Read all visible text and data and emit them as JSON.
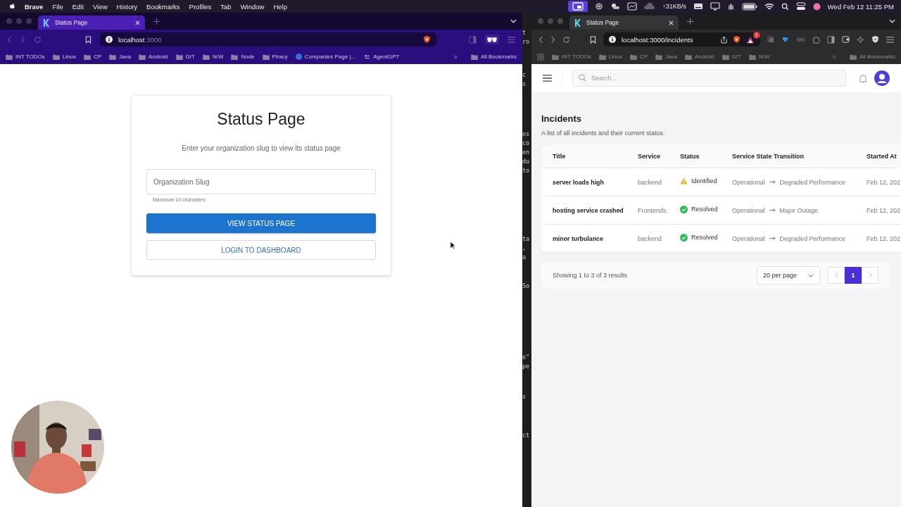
{
  "menu_bar": {
    "app": "Brave",
    "menus": [
      "File",
      "Edit",
      "View",
      "History",
      "Bookmarks",
      "Profiles",
      "Tab",
      "Window",
      "Help"
    ],
    "network_speed": "↑31KB/s",
    "clock": "Wed Feb 12  11:25 PM"
  },
  "left_browser": {
    "tab_title": "Status Page",
    "address": {
      "host": "localhost",
      "port": ":3000"
    },
    "bookmarks": [
      {
        "label": "INT TODOs",
        "kind": "folder"
      },
      {
        "label": "Linux",
        "kind": "folder"
      },
      {
        "label": "CP",
        "kind": "folder"
      },
      {
        "label": "Java",
        "kind": "folder"
      },
      {
        "label": "Android",
        "kind": "folder"
      },
      {
        "label": "GIT",
        "kind": "folder"
      },
      {
        "label": "N/W",
        "kind": "folder"
      },
      {
        "label": "Node",
        "kind": "folder"
      },
      {
        "label": "Piracy",
        "kind": "folder"
      },
      {
        "label": "Companies Page |...",
        "kind": "site"
      },
      {
        "label": "AgentGPT",
        "kind": "link"
      }
    ],
    "overflow": "»",
    "all_bookmarks": "All Bookmarks"
  },
  "status_card": {
    "title": "Status Page",
    "subtitle": "Enter your organization slug to view its status page",
    "slug_field": {
      "placeholder": "Organization Slug",
      "helper": "Maximum 10 characters"
    },
    "primary_button": "VIEW STATUS PAGE",
    "secondary_button": "LOGIN TO DASHBOARD"
  },
  "terminal": {
    "blocks": [
      [
        "t",
        "ro"
      ],
      [
        "c",
        "s"
      ],
      [
        "es",
        "co",
        "en",
        "du",
        "to"
      ],
      [
        "ta",
        ",",
        "a"
      ],
      [
        "So"
      ],
      [
        "e\"",
        "pe"
      ],
      [
        "s"
      ],
      [
        "ct"
      ]
    ]
  },
  "right_browser": {
    "tab_title": "Status Page",
    "address": "localhost:3000/incidents",
    "extension_badge": "1",
    "bookmarks": [
      {
        "label": "INT TODOs",
        "kind": "folder"
      },
      {
        "label": "Linux",
        "kind": "folder"
      },
      {
        "label": "CP",
        "kind": "folder"
      },
      {
        "label": "Java",
        "kind": "folder"
      },
      {
        "label": "Android",
        "kind": "folder"
      },
      {
        "label": "GIT",
        "kind": "folder"
      },
      {
        "label": "N/W",
        "kind": "folder"
      }
    ],
    "overflow": "»",
    "all_bookmarks": "All Bookmarks"
  },
  "incidents_app": {
    "search": {
      "placeholder": "Search..."
    },
    "heading": "Incidents",
    "description": "A list of all incidents and their current status.",
    "table": {
      "columns": [
        "Title",
        "Service",
        "Status",
        "Service State Transition",
        "Started At"
      ],
      "rows": [
        {
          "title": "server loads high",
          "service": "backend",
          "status": {
            "kind": "identified",
            "label": "Identified"
          },
          "from": "Operational",
          "to": "Degraded Performance",
          "started": "Feb 12, 202"
        },
        {
          "title": "hosting service crashed",
          "service": "Frontends",
          "status": {
            "kind": "resolved",
            "label": "Resolved"
          },
          "from": "Operational",
          "to": "Major Outage",
          "started": "Feb 12, 202"
        },
        {
          "title": "minor turbulance",
          "service": "backend",
          "status": {
            "kind": "resolved",
            "label": "Resolved"
          },
          "from": "Operational",
          "to": "Degraded Performance",
          "started": "Feb 12, 202"
        }
      ]
    },
    "pagination": {
      "summary": "Showing 1 to 3 of 3 results",
      "per_page": "20 per page",
      "pages": [
        {
          "label": "1",
          "selected": true
        }
      ]
    }
  }
}
